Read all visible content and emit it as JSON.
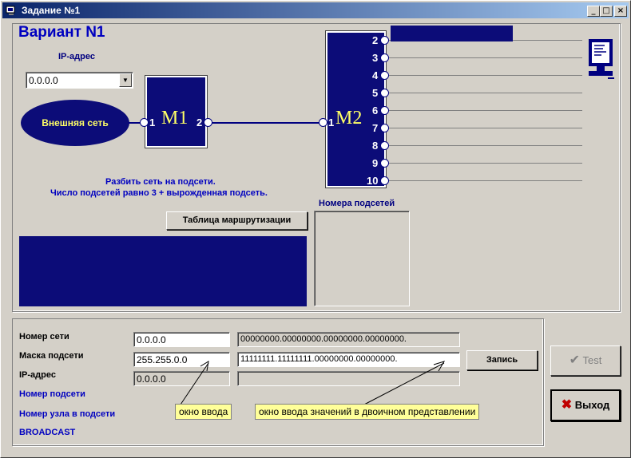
{
  "window": {
    "title": "Задание №1",
    "controls": [
      "_",
      "□",
      "×"
    ]
  },
  "variant": "Вариант N1",
  "ip_label": "IP-адрес",
  "ip_combo": {
    "value": "0.0.0.0"
  },
  "external_net": "Внешняя сеть",
  "routers": {
    "m1": {
      "label": "M1",
      "ports": [
        "1",
        "2"
      ]
    },
    "m2": {
      "label": "M2",
      "in_port": "1",
      "ports": [
        "2",
        "3",
        "4",
        "5",
        "6",
        "7",
        "8",
        "9",
        "10"
      ]
    }
  },
  "task": {
    "line1": "Разбить сеть на подсети.",
    "line2": "Число подсетей равно 3 + вырожденная подсеть."
  },
  "routing_table_button": "Таблица маршрутизации",
  "subnets_label": "Номера подсетей",
  "form": {
    "network_label": "Номер сети",
    "network_value": "0.0.0.0",
    "network_binary": "00000000.00000000.00000000.00000000.",
    "mask_label": "Маска подсети",
    "mask_value": "255.255.0.0",
    "mask_binary": "11111111.11111111.00000000.00000000.",
    "ip_label": "IP-адрес",
    "ip_value": "0.0.0.0",
    "ip_binary": "",
    "subnet_label": "Номер подсети",
    "host_label": "Номер узла в подсети",
    "broadcast_label": "BROADCAST",
    "write_button": "Запись"
  },
  "tips": {
    "input": "окно ввода",
    "binary_input": "окно ввода значений в двоичном представлении"
  },
  "buttons": {
    "test": "Test",
    "exit": "Выход"
  },
  "colors": {
    "navy": "#0c0c78",
    "label_blue": "#0000c0",
    "port_digit": "#ffff66"
  }
}
